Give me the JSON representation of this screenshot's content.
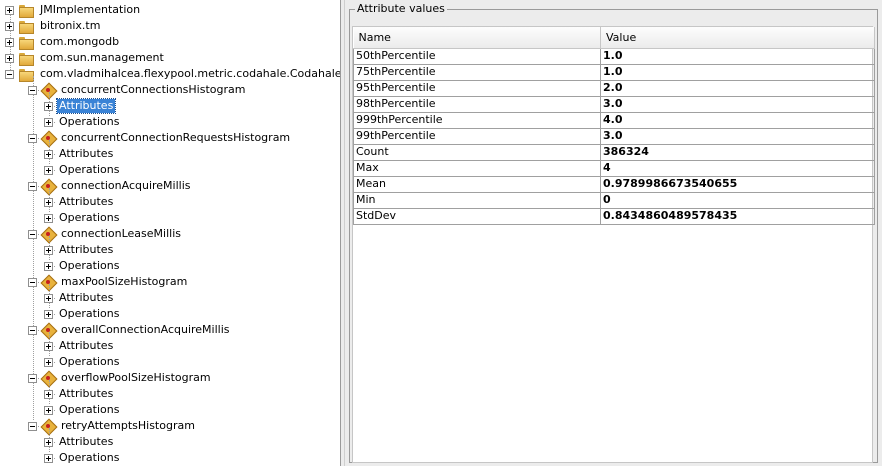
{
  "tree": {
    "roots": [
      {
        "label": "JMImplementation",
        "expanded": false
      },
      {
        "label": "bitronix.tm",
        "expanded": false
      },
      {
        "label": "com.mongodb",
        "expanded": false
      },
      {
        "label": "com.sun.management",
        "expanded": false
      },
      {
        "label": "com.vladmihalcea.flexypool.metric.codahale.CodahaleMetrics.",
        "expanded": true
      }
    ],
    "beans": [
      {
        "label": "concurrentConnectionsHistogram"
      },
      {
        "label": "concurrentConnectionRequestsHistogram"
      },
      {
        "label": "connectionAcquireMillis"
      },
      {
        "label": "connectionLeaseMillis"
      },
      {
        "label": "maxPoolSizeHistogram"
      },
      {
        "label": "overallConnectionAcquireMillis"
      },
      {
        "label": "overflowPoolSizeHistogram"
      },
      {
        "label": "retryAttemptsHistogram"
      }
    ],
    "attributes_label": "Attributes",
    "operations_label": "Operations",
    "selected": "concurrentConnectionsHistogram/Attributes"
  },
  "panel": {
    "title": "Attribute values",
    "columns": [
      "Name",
      "Value"
    ],
    "rows": [
      {
        "name": "50thPercentile",
        "value": "1.0"
      },
      {
        "name": "75thPercentile",
        "value": "1.0"
      },
      {
        "name": "95thPercentile",
        "value": "2.0"
      },
      {
        "name": "98thPercentile",
        "value": "3.0"
      },
      {
        "name": "999thPercentile",
        "value": "4.0"
      },
      {
        "name": "99thPercentile",
        "value": "3.0"
      },
      {
        "name": "Count",
        "value": "386324"
      },
      {
        "name": "Max",
        "value": "4"
      },
      {
        "name": "Mean",
        "value": "0.9789986673540655"
      },
      {
        "name": "Min",
        "value": "0"
      },
      {
        "name": "StdDev",
        "value": "0.8434860489578435"
      }
    ]
  },
  "colors": {
    "selection": "#3a83d6",
    "panel_background": "#ececec",
    "folder": "#f7d77a",
    "bean": "#e8b23c"
  }
}
